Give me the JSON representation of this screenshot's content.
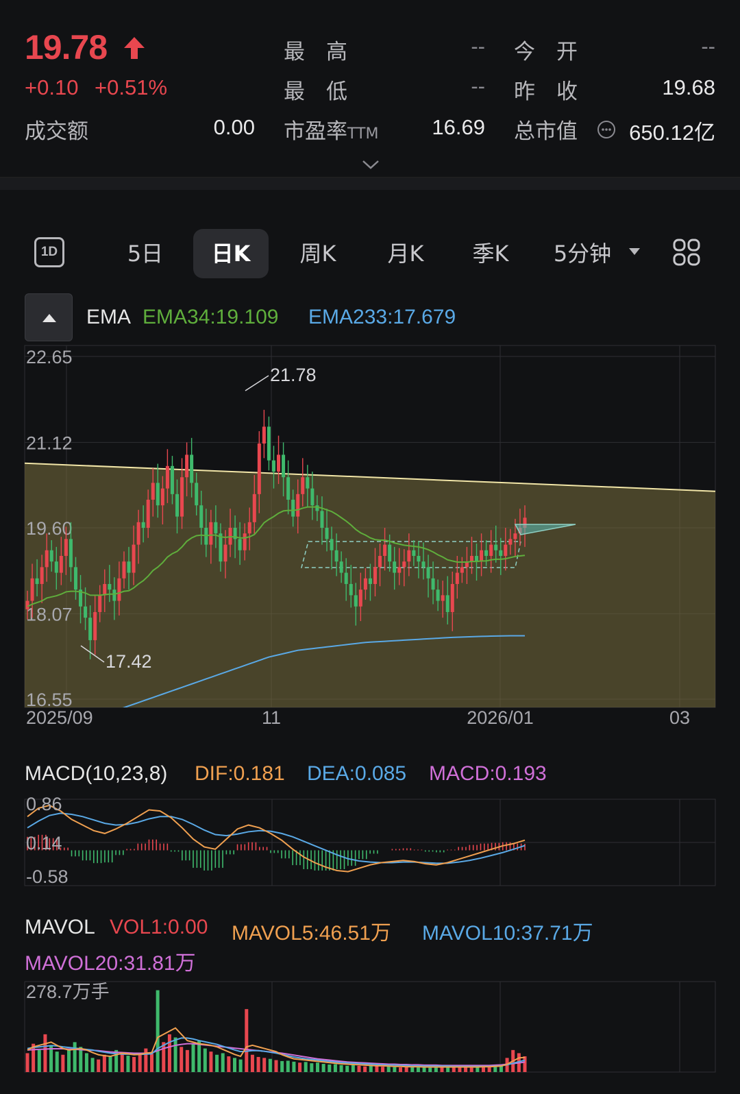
{
  "quote": {
    "price": "19.78",
    "change": "+0.10",
    "change_pct": "+0.51%",
    "turnover_label": "成交额",
    "turnover_value": "0.00",
    "high_label": "最　高",
    "high_value": "--",
    "low_label": "最　低",
    "low_value": "--",
    "pe_label": "市盈率",
    "pe_suffix": "TTM",
    "pe_value": "16.69",
    "open_label": "今　开",
    "open_value": "--",
    "prev_close_label": "昨　收",
    "prev_close_value": "19.68",
    "mktcap_label": "总市值",
    "mktcap_value": "650.12亿",
    "colors": {
      "up": "#e8474f",
      "down": "#3fb96c"
    }
  },
  "tabs": [
    {
      "label": "5日"
    },
    {
      "label": "日K",
      "active": true
    },
    {
      "label": "周K"
    },
    {
      "label": "月K"
    },
    {
      "label": "季K"
    },
    {
      "label": "5分钟"
    }
  ],
  "icons": {
    "oneday": "1D",
    "menu": "grid-icon",
    "dropdown": "caret-down-icon",
    "collapse": "caret-up-icon"
  },
  "ema_legend": {
    "name": "EMA",
    "ema34": "EMA34:19.109",
    "ema233": "EMA233:17.679",
    "ema34_color": "#5fae3c",
    "ema233_color": "#5aa9e6"
  },
  "macd_legend": {
    "name": "MACD(10,23,8)",
    "dif": "DIF:0.181",
    "dea": "DEA:0.085",
    "macd": "MACD:0.193",
    "dif_color": "#f0a050",
    "dea_color": "#5aa9e6",
    "macd_color": "#d070d8"
  },
  "mavol_legend": {
    "name": "MAVOL",
    "vol1": "VOL1:0.00",
    "mavol5": "MAVOL5:46.51万",
    "mavol10": "MAVOL10:37.71万",
    "mavol20": "MAVOL20:31.81万"
  },
  "chart_data": [
    {
      "type": "candlestick",
      "ylim": [
        16.55,
        22.65
      ],
      "y_ticks": [
        "22.65",
        "21.12",
        "19.60",
        "18.07",
        "16.55"
      ],
      "x_ticks": [
        "2025/09",
        "11",
        "2026/01",
        "03"
      ],
      "annotations": [
        "21.78",
        "17.42"
      ],
      "trendline": {
        "start": 20.75,
        "end": 20.25
      },
      "close": [
        18.3,
        18.7,
        18.6,
        18.9,
        19.2,
        19.0,
        18.8,
        19.1,
        19.4,
        18.9,
        18.5,
        18.2,
        18.0,
        17.6,
        18.1,
        18.4,
        18.6,
        18.5,
        18.3,
        18.7,
        19.0,
        18.8,
        19.3,
        19.7,
        19.6,
        20.1,
        20.4,
        20.0,
        20.3,
        20.7,
        20.2,
        19.8,
        20.5,
        20.9,
        20.4,
        20.0,
        19.6,
        19.3,
        19.7,
        19.5,
        19.0,
        19.3,
        19.6,
        19.4,
        19.2,
        19.5,
        19.7,
        20.2,
        21.1,
        21.4,
        20.8,
        20.6,
        20.9,
        20.5,
        20.1,
        19.8,
        20.2,
        20.5,
        20.3,
        20.0,
        19.9,
        19.6,
        19.4,
        19.2,
        19.0,
        18.8,
        18.6,
        18.4,
        18.2,
        18.5,
        18.7,
        18.6,
        18.9,
        19.1,
        19.3,
        19.0,
        18.8,
        18.9,
        19.0,
        19.2,
        19.1,
        19.0,
        18.9,
        18.7,
        18.5,
        18.3,
        18.4,
        18.1,
        18.6,
        18.8,
        18.9,
        19.0,
        19.1,
        19.0,
        19.2,
        19.1,
        19.3,
        19.2,
        19.1,
        19.3,
        19.4,
        19.5,
        19.6,
        19.78
      ],
      "ema34": [
        18.2,
        18.24,
        18.27,
        18.3,
        18.35,
        18.37,
        18.39,
        18.42,
        18.46,
        18.47,
        18.47,
        18.46,
        18.44,
        18.4,
        18.4,
        18.4,
        18.41,
        18.42,
        18.42,
        18.44,
        18.47,
        18.48,
        18.53,
        18.6,
        18.66,
        18.74,
        18.84,
        18.9,
        18.98,
        19.08,
        19.14,
        19.18,
        19.26,
        19.36,
        19.42,
        19.46,
        19.47,
        19.46,
        19.47,
        19.47,
        19.44,
        19.43,
        19.44,
        19.44,
        19.42,
        19.42,
        19.44,
        19.48,
        19.58,
        19.69,
        19.75,
        19.8,
        19.86,
        19.9,
        19.91,
        19.91,
        19.92,
        19.95,
        19.97,
        19.97,
        19.97,
        19.95,
        19.92,
        19.89,
        19.84,
        19.78,
        19.72,
        19.65,
        19.57,
        19.51,
        19.47,
        19.42,
        19.39,
        19.38,
        19.38,
        19.36,
        19.33,
        19.31,
        19.29,
        19.28,
        19.27,
        19.26,
        19.24,
        19.21,
        19.17,
        19.12,
        19.08,
        19.03,
        19.01,
        18.99,
        18.99,
        18.99,
        19.0,
        19.0,
        19.01,
        19.01,
        19.03,
        19.04,
        19.04,
        19.05,
        19.07,
        19.09,
        19.1,
        19.109
      ],
      "ema233": [
        15.8,
        15.83,
        15.86,
        15.89,
        15.92,
        15.95,
        15.98,
        16.01,
        16.04,
        16.07,
        16.1,
        16.13,
        16.16,
        16.19,
        16.22,
        16.25,
        16.28,
        16.31,
        16.34,
        16.37,
        16.4,
        16.43,
        16.46,
        16.49,
        16.52,
        16.55,
        16.58,
        16.61,
        16.64,
        16.67,
        16.7,
        16.73,
        16.76,
        16.79,
        16.82,
        16.85,
        16.88,
        16.91,
        16.94,
        16.97,
        17.0,
        17.03,
        17.06,
        17.09,
        17.12,
        17.15,
        17.18,
        17.21,
        17.24,
        17.27,
        17.3,
        17.32,
        17.34,
        17.36,
        17.38,
        17.4,
        17.42,
        17.43,
        17.44,
        17.45,
        17.46,
        17.47,
        17.48,
        17.49,
        17.5,
        17.51,
        17.52,
        17.53,
        17.54,
        17.55,
        17.56,
        17.565,
        17.57,
        17.575,
        17.58,
        17.585,
        17.59,
        17.595,
        17.6,
        17.605,
        17.61,
        17.615,
        17.62,
        17.625,
        17.63,
        17.635,
        17.64,
        17.645,
        17.65,
        17.653,
        17.656,
        17.659,
        17.662,
        17.665,
        17.668,
        17.67,
        17.672,
        17.674,
        17.676,
        17.677,
        17.678,
        17.678,
        17.679,
        17.679
      ]
    },
    {
      "type": "line",
      "name": "MACD",
      "ylim": [
        -0.58,
        0.86
      ],
      "y_ticks": [
        "0.86",
        "0.14",
        "-0.58"
      ],
      "dif": [
        0.6,
        0.75,
        0.8,
        0.7,
        0.55,
        0.45,
        0.35,
        0.3,
        0.38,
        0.48,
        0.6,
        0.72,
        0.7,
        0.58,
        0.4,
        0.2,
        0.06,
        0.02,
        0.2,
        0.38,
        0.45,
        0.4,
        0.3,
        0.18,
        0.02,
        -0.12,
        -0.22,
        -0.3,
        -0.36,
        -0.38,
        -0.32,
        -0.26,
        -0.22,
        -0.2,
        -0.18,
        -0.2,
        -0.24,
        -0.26,
        -0.22,
        -0.16,
        -0.1,
        -0.04,
        0.02,
        0.08,
        0.12,
        0.18
      ],
      "dea": [
        0.4,
        0.52,
        0.62,
        0.66,
        0.64,
        0.6,
        0.54,
        0.48,
        0.45,
        0.46,
        0.5,
        0.56,
        0.6,
        0.6,
        0.55,
        0.46,
        0.36,
        0.28,
        0.26,
        0.29,
        0.33,
        0.35,
        0.34,
        0.3,
        0.24,
        0.16,
        0.08,
        0.0,
        -0.08,
        -0.15,
        -0.19,
        -0.21,
        -0.22,
        -0.22,
        -0.21,
        -0.21,
        -0.22,
        -0.23,
        -0.23,
        -0.21,
        -0.18,
        -0.14,
        -0.09,
        -0.04,
        0.02,
        0.085
      ],
      "macd": [
        0.4,
        0.46,
        0.36,
        0.08,
        -0.18,
        -0.3,
        -0.38,
        -0.36,
        -0.14,
        0.04,
        0.2,
        0.32,
        0.2,
        -0.04,
        -0.3,
        -0.52,
        -0.6,
        -0.52,
        -0.12,
        0.18,
        0.24,
        0.1,
        -0.08,
        -0.24,
        -0.44,
        -0.56,
        -0.6,
        -0.6,
        -0.56,
        -0.46,
        -0.26,
        -0.1,
        0.0,
        0.04,
        0.06,
        0.02,
        -0.04,
        -0.06,
        0.02,
        0.1,
        0.16,
        0.2,
        0.22,
        0.24,
        0.2,
        0.193
      ]
    },
    {
      "type": "bar",
      "name": "MAVOL",
      "ylim": [
        0,
        278.7
      ],
      "y_ticks": [
        "278.7万手"
      ],
      "volume": [
        60,
        90,
        70,
        120,
        85,
        65,
        55,
        70,
        95,
        80,
        60,
        45,
        40,
        55,
        50,
        70,
        60,
        52,
        48,
        62,
        75,
        58,
        260,
        95,
        120,
        110,
        80,
        70,
        90,
        100,
        75,
        65,
        55,
        60,
        50,
        45,
        40,
        200,
        55,
        48,
        45,
        42,
        38,
        35,
        36,
        33,
        30,
        32,
        28,
        30,
        26,
        24,
        25,
        22,
        20,
        22,
        20,
        18,
        20,
        19,
        17,
        18,
        16,
        15,
        17,
        18,
        16,
        15,
        14,
        16,
        15,
        17,
        16,
        18,
        15,
        14,
        16,
        17,
        18,
        20,
        22,
        45,
        70,
        60,
        50
      ],
      "mavol5": [
        70,
        80,
        85,
        90,
        95,
        85,
        75,
        70,
        72,
        75,
        70,
        62,
        55,
        52,
        50,
        55,
        60,
        58,
        55,
        56,
        60,
        62,
        110,
        120,
        130,
        140,
        120,
        100,
        95,
        90,
        88,
        85,
        80,
        72,
        64,
        56,
        50,
        80,
        85,
        80,
        75,
        70,
        65,
        55,
        48,
        42,
        40,
        38,
        36,
        34,
        32,
        30,
        28,
        26,
        25,
        24,
        23,
        22,
        21,
        20,
        20,
        19,
        18,
        18,
        17,
        17,
        17,
        16,
        16,
        16,
        16,
        16,
        16,
        16,
        16,
        16,
        16,
        17,
        17,
        18,
        19,
        25,
        35,
        45,
        46.51
      ],
      "mavol10": [
        75,
        78,
        80,
        82,
        84,
        83,
        80,
        78,
        76,
        74,
        72,
        70,
        66,
        63,
        60,
        58,
        57,
        57,
        56,
        56,
        57,
        58,
        75,
        85,
        95,
        102,
        108,
        108,
        105,
        100,
        96,
        92,
        88,
        82,
        76,
        70,
        65,
        66,
        68,
        68,
        66,
        63,
        60,
        56,
        52,
        48,
        45,
        42,
        40,
        38,
        36,
        34,
        32,
        30,
        29,
        28,
        27,
        26,
        25,
        24,
        23,
        22,
        22,
        21,
        21,
        20,
        20,
        19,
        19,
        19,
        19,
        19,
        18,
        18,
        18,
        18,
        18,
        18,
        18,
        19,
        20,
        23,
        28,
        33,
        37.71
      ],
      "mavol20": [
        70,
        71,
        72,
        73,
        74,
        74,
        74,
        73,
        72,
        71,
        70,
        69,
        68,
        66,
        64,
        63,
        62,
        61,
        60,
        60,
        60,
        61,
        68,
        75,
        80,
        85,
        88,
        90,
        90,
        88,
        86,
        84,
        82,
        80,
        78,
        76,
        74,
        72,
        70,
        68,
        66,
        64,
        62,
        60,
        57,
        54,
        51,
        48,
        45,
        42,
        40,
        38,
        36,
        34,
        32,
        31,
        30,
        29,
        28,
        27,
        26,
        25,
        25,
        24,
        24,
        23,
        23,
        22,
        22,
        22,
        21,
        21,
        21,
        21,
        21,
        21,
        21,
        21,
        21,
        22,
        23,
        25,
        27,
        29,
        31.81
      ]
    }
  ]
}
